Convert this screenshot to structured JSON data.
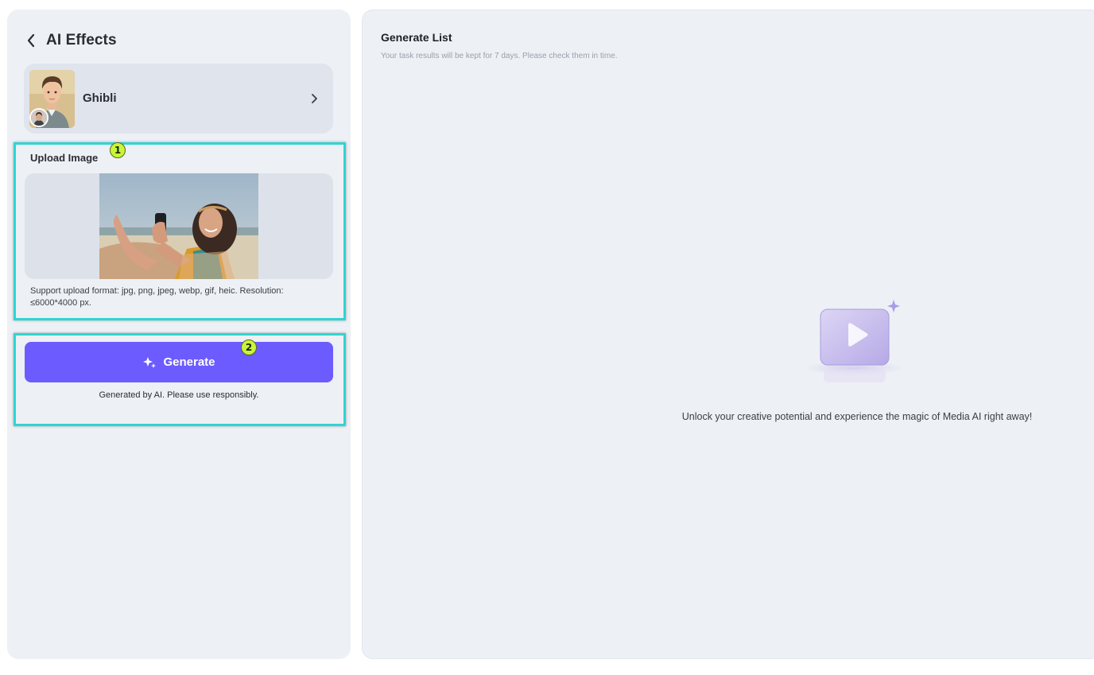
{
  "header": {
    "title": "AI Effects",
    "back_icon": "chevron-left-icon"
  },
  "effect": {
    "name": "Ghibli",
    "chevron_icon": "chevron-right-icon"
  },
  "upload": {
    "label": "Upload Image",
    "support_text": "Support upload format: jpg, png, jpeg, webp, gif, heic. Resolution: ≤6000*4000 px."
  },
  "generate": {
    "label": "Generate",
    "icon": "sparkle-icon",
    "disclaimer": "Generated by AI. Please use responsibly."
  },
  "annotations": {
    "badge1": "1",
    "badge2": "2",
    "highlight_color": "#2fd5d2",
    "badge_color": "#c8f53a"
  },
  "generate_list": {
    "title": "Generate List",
    "subtitle": "Your task results will be kept for 7 days. Please check them in time.",
    "empty_message": "Unlock your creative potential and experience the magic of Media AI right away!",
    "empty_icon": "video-play-icon"
  },
  "colors": {
    "accent": "#6c5cff",
    "panel_bg": "#edf0f5"
  }
}
